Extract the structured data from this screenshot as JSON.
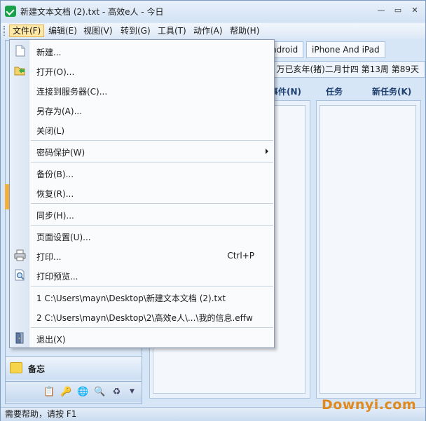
{
  "window": {
    "title": "新建文本文档 (2).txt - 高效e人 - 今日"
  },
  "menubar": {
    "items": [
      "文件(F)",
      "编辑(E)",
      "视图(V)",
      "转到(G)",
      "工具(T)",
      "动作(A)",
      "帮助(H)"
    ]
  },
  "tabs": [
    "ndroid",
    "iPhone And iPad"
  ],
  "datebar": {
    "text": "万已亥年(猪)二月廿四  第13周 第89天"
  },
  "panes": {
    "events_header": "事件(N)",
    "tasks_header": "任务",
    "new_task": "新任务(K)"
  },
  "nav": {
    "memo_label": "备忘"
  },
  "statusbar": {
    "text": "需要帮助，请按 F1"
  },
  "watermark": "Downyi.com",
  "file_menu": {
    "new": "新建...",
    "open": "打开(O)...",
    "connect": "连接到服务器(C)...",
    "save_as": "另存为(A)...",
    "close": "关闭(L)",
    "password": "密码保护(W)",
    "backup": "备份(B)...",
    "restore": "恢复(R)...",
    "sync": "同步(H)...",
    "page_setup": "页面设置(U)...",
    "print": "打印...",
    "print_shortcut": "Ctrl+P",
    "print_preview": "打印预览...",
    "recent1": "1 C:\\Users\\mayn\\Desktop\\新建文本文档 (2).txt",
    "recent2": "2 C:\\Users\\mayn\\Desktop\\2\\高效e人\\...\\我的信息.effw",
    "exit": "退出(X)"
  }
}
